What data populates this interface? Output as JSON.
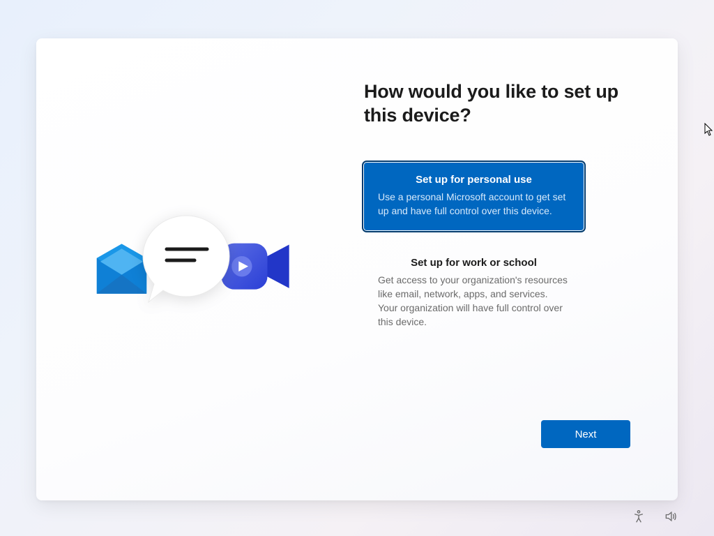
{
  "heading": "How would you like to set up this device?",
  "options": {
    "personal": {
      "title": "Set up for personal use",
      "desc": "Use a personal Microsoft account to get set up and have full control over this device."
    },
    "work": {
      "title": "Set up for work or school",
      "desc": "Get access to your organization's resources like email, network, apps, and services. Your organization will have full control over this device."
    }
  },
  "buttons": {
    "next": "Next"
  },
  "colors": {
    "accent": "#0067c0"
  }
}
